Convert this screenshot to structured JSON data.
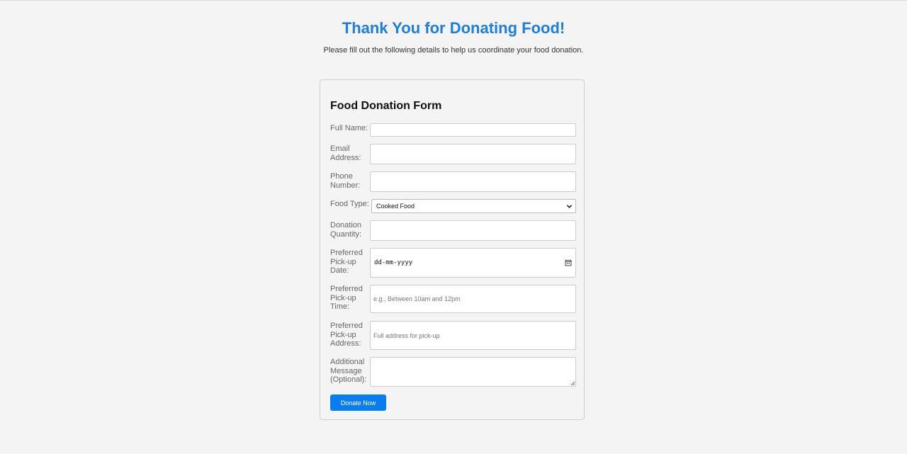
{
  "header": {
    "title": "Thank You for Donating Food!",
    "subtitle": "Please fill out the following details to help us coordinate your food donation."
  },
  "form": {
    "heading": "Food Donation Form",
    "fields": {
      "full_name": {
        "label": "Full Name:",
        "value": "",
        "placeholder": ""
      },
      "email": {
        "label": "Email Address:",
        "value": "",
        "placeholder": ""
      },
      "phone": {
        "label": "Phone Number:",
        "value": "",
        "placeholder": ""
      },
      "food_type": {
        "label": "Food Type:",
        "selected": "Cooked Food"
      },
      "quantity": {
        "label": "Donation Quantity:",
        "value": "",
        "placeholder": ""
      },
      "pickup_date": {
        "label": "Preferred Pick-up Date:",
        "display": "dd-mm-yyyy"
      },
      "pickup_time": {
        "label": "Preferred Pick-up Time:",
        "value": "",
        "placeholder": "e.g., Between 10am and 12pm"
      },
      "pickup_address": {
        "label": "Preferred Pick-up Address:",
        "value": "",
        "placeholder": "Full address for pick-up"
      },
      "message": {
        "label": "Additional Message (Optional):",
        "value": "",
        "placeholder": ""
      }
    },
    "submit_label": "Donate Now"
  },
  "icons": {
    "food_type_dropdown": "chevron-down-icon",
    "pickup_date": "calendar-icon",
    "message": "resize-grip-icon"
  },
  "colors": {
    "title": "#1a7fe0",
    "button": "#0a7cf2",
    "background": "#f4f4f4"
  }
}
